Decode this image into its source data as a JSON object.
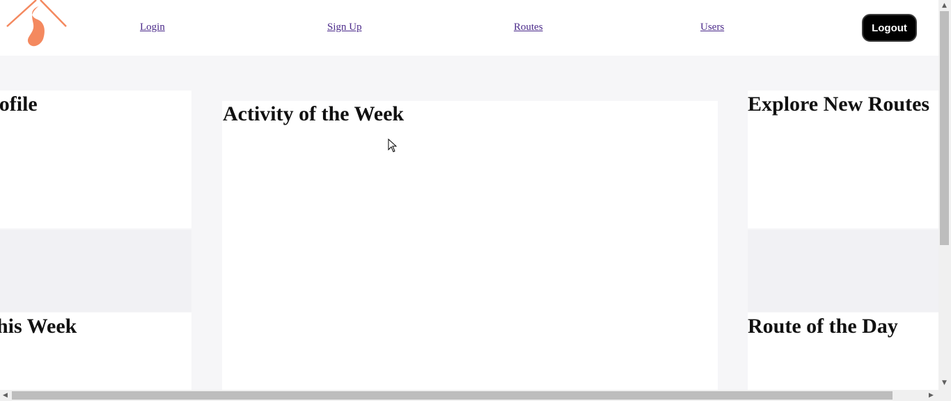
{
  "nav": {
    "links": [
      "Login",
      "Sign Up",
      "Routes",
      "Users"
    ],
    "logout_label": "Logout",
    "link_color": "#4b2a8a"
  },
  "cards": {
    "profile_title": "rofile",
    "activity_title": "Activity of the Week",
    "explore_title": "Explore New Routes",
    "this_week_title": "his Week",
    "route_of_day_title": "Route of the Day"
  },
  "colors": {
    "logo_orange": "#f4895f",
    "background": "#f6f6f8",
    "card": "#ffffff",
    "button": "#000000"
  },
  "icons": {
    "logo": "runner-route-logo-icon",
    "cursor": "mouse-pointer-icon"
  }
}
